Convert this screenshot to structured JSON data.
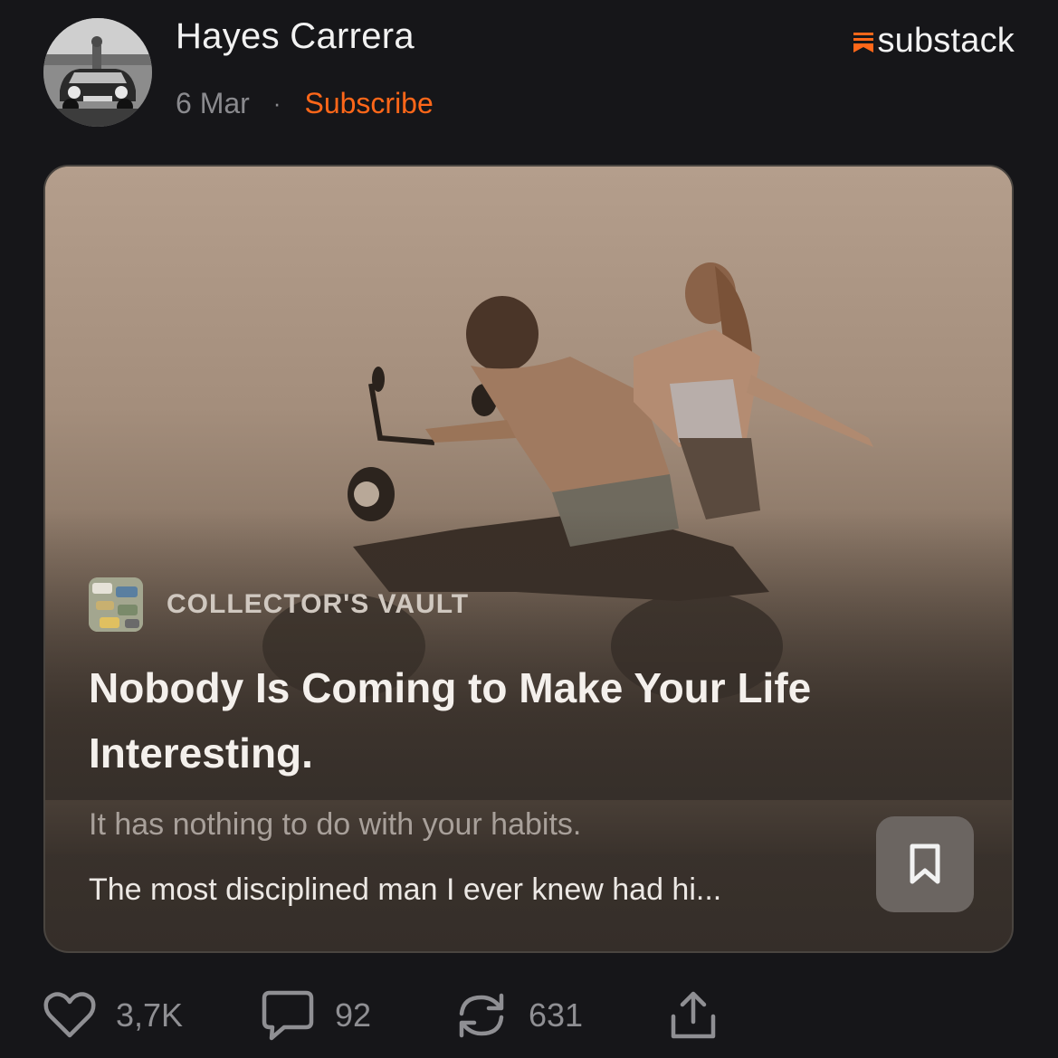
{
  "header": {
    "author_name": "Hayes Carrera",
    "post_date": "6 Mar",
    "separator": "·",
    "subscribe_label": "Subscribe",
    "brand_name": "substack",
    "brand_color": "#ff6719"
  },
  "card": {
    "publication_name": "COLLECTOR'S VAULT",
    "title": "Nobody Is Coming to Make Your Life Interesting.",
    "subtitle": "It has nothing to do with your habits.",
    "excerpt": "The most disciplined man I ever knew had hi...",
    "bookmark_icon": "bookmark-icon"
  },
  "actions": {
    "likes": "3,7K",
    "comments": "92",
    "restacks": "631",
    "like_icon": "heart-icon",
    "comment_icon": "comment-icon",
    "restack_icon": "restack-icon",
    "share_icon": "share-icon"
  },
  "colors": {
    "background": "#161619",
    "accent": "#ff6719",
    "muted": "#8f8f93"
  }
}
